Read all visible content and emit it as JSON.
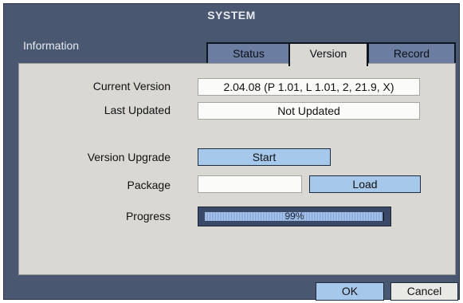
{
  "window": {
    "title": "SYSTEM"
  },
  "section": {
    "label": "Information"
  },
  "tabs": [
    {
      "label": "Status",
      "active": false
    },
    {
      "label": "Version",
      "active": true
    },
    {
      "label": "Record",
      "active": false
    }
  ],
  "version": {
    "current_label": "Current Version",
    "current_value": "2.04.08 (P 1.01, L 1.01, 2, 21.9, X)",
    "updated_label": "Last Updated",
    "updated_value": "Not Updated"
  },
  "upgrade": {
    "label": "Version Upgrade",
    "start_label": "Start",
    "package_label": "Package",
    "package_value": "",
    "load_label": "Load",
    "progress_label": "Progress",
    "progress_text": "99%",
    "progress_fraction": 0.99
  },
  "footer": {
    "ok_label": "OK",
    "cancel_label": "Cancel"
  },
  "colors": {
    "window_bg": "#4a5770",
    "panel_bg": "#d9d8d3",
    "button_blue": "#a6c8ea"
  }
}
